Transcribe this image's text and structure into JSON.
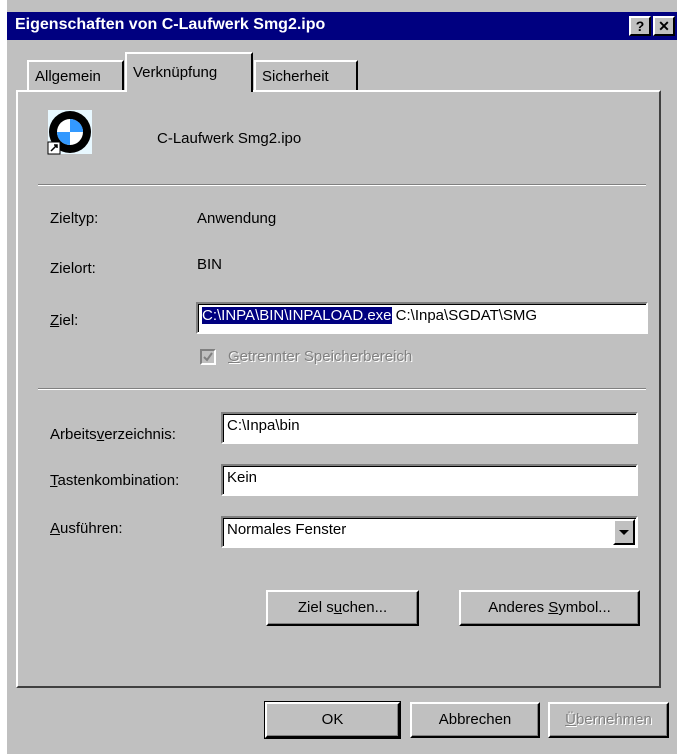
{
  "window": {
    "title": "Eigenschaften von C-Laufwerk    Smg2.ipo"
  },
  "titlebar_buttons": {
    "help": "?",
    "close": "✕"
  },
  "tabs": [
    {
      "label": "Allgemein",
      "active": false
    },
    {
      "label": "Verknüpfung",
      "active": true
    },
    {
      "label": "Sicherheit",
      "active": false
    }
  ],
  "shortcut": {
    "name": "C-Laufwerk  Smg2.ipo",
    "icon": "bmw-logo-icon"
  },
  "fields": {
    "zieltyp": {
      "label": "Zieltyp:",
      "value": "Anwendung"
    },
    "zielort": {
      "label": "Zielort:",
      "value": "BIN"
    },
    "ziel": {
      "label_pre": "",
      "label_u": "Z",
      "label_post": "iel:",
      "selected": "C:\\INPA\\BIN\\INPALOAD.exe",
      "rest": " C:\\Inpa\\SGDAT\\SMG"
    },
    "checkbox": {
      "label_u": "G",
      "label_post": "etrennter Speicherbereich",
      "checked": true,
      "disabled": true
    },
    "arbeitsverzeichnis": {
      "label_pre": "Arbeits",
      "label_u": "v",
      "label_post": "erzeichnis:",
      "value": "C:\\Inpa\\bin"
    },
    "tastenkombination": {
      "label_u": "T",
      "label_post": "astenkombination:",
      "value": "Kein"
    },
    "ausfuehren": {
      "label_u": "A",
      "label_post": "usführen:",
      "value": "Normales Fenster"
    }
  },
  "buttons": {
    "ziel_suchen": {
      "pre": "Ziel s",
      "u": "u",
      "post": "chen..."
    },
    "anderes_symbol": {
      "pre": "Anderes ",
      "u": "S",
      "post": "ymbol..."
    },
    "ok": "OK",
    "abbrechen": "Abbrechen",
    "uebernehmen": {
      "u": "Ü",
      "post": "bernehmen"
    }
  },
  "colors": {
    "titlebar": "#000080",
    "face": "#c0c0c0",
    "selection": "#000080"
  }
}
